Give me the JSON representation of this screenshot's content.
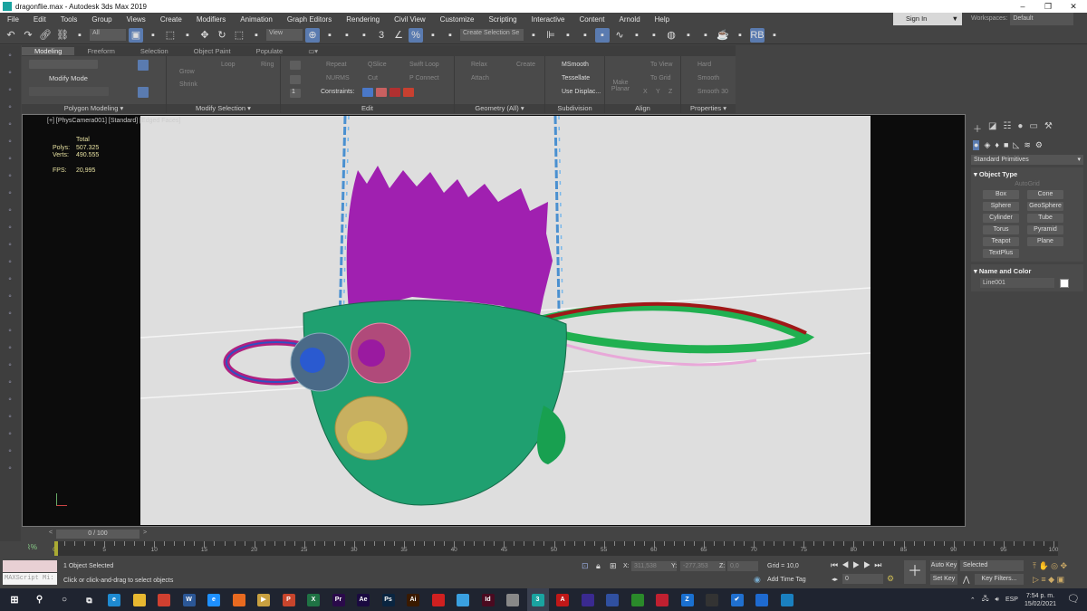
{
  "window": {
    "title": "dragonflie.max - Autodesk 3ds Max 2019",
    "minimize": "–",
    "restore": "❐",
    "close": "✕"
  },
  "menu": [
    "File",
    "Edit",
    "Tools",
    "Group",
    "Views",
    "Create",
    "Modifiers",
    "Animation",
    "Graph Editors",
    "Rendering",
    "Civil View",
    "Customize",
    "Scripting",
    "Interactive",
    "Content",
    "Arnold",
    "Help"
  ],
  "account": {
    "sign_in": "Sign In",
    "workspaces_label": "Workspaces:",
    "workspace": "Default"
  },
  "toolbar": {
    "selection_filter": "All",
    "ref_coord": "View",
    "named_selection": "Create Selection Se",
    "icons": [
      "undo-icon",
      "redo-icon",
      "link-icon",
      "unlink-icon",
      "bind-space-warp-icon",
      "select-object-icon",
      "select-by-name-icon",
      "rect-region-icon",
      "window-crossing-icon",
      "move-icon",
      "rotate-icon",
      "scale-icon",
      "place-icon",
      "pivot-icon",
      "mirror-icon",
      "select-manipulate-icon",
      "keyboard-shortcut-icon",
      "snap-3d-icon",
      "angle-snap-icon",
      "percent-snap-icon",
      "spinner-snap-icon",
      "edit-named-sets-icon",
      "mirror-tool-icon",
      "align-icon",
      "scene-explorer-icon",
      "layer-explorer-icon",
      "toggle-ribbon-icon",
      "curve-editor-icon",
      "dope-sheet-icon",
      "schematic-view-icon",
      "material-editor-icon",
      "render-setup-icon",
      "rendered-frame-icon",
      "render-icon",
      "render-iterative-icon",
      "rb-icon",
      "viewport-layout-icon"
    ]
  },
  "ribbon": {
    "tabs": [
      "Modeling",
      "Freeform",
      "Selection",
      "Object Paint",
      "Populate"
    ],
    "selected_tab": "Modeling",
    "panels": {
      "polygon_modeling": {
        "label": "Polygon Modeling ▾",
        "modify_mode": "Modify Mode"
      },
      "modify_selection": {
        "label": "Modify Selection ▾",
        "grow": "Grow",
        "shrink": "Shrink",
        "loop": "Loop",
        "ring": "Ring"
      },
      "edit": {
        "label": "Edit",
        "repeat": "Repeat",
        "qslice": "QSlice",
        "swift_loop": "Swift Loop",
        "nurms": "NURMS",
        "cut": "Cut",
        "p_connect": "P Connect",
        "constraints": "Constraints:",
        "spinner_value": "1"
      },
      "geometry": {
        "label": "Geometry (All) ▾",
        "relax": "Relax",
        "create": "Create",
        "attach": "Attach"
      },
      "subdivision": {
        "label": "Subdivision",
        "msmooth": "MSmooth",
        "tessellate": "Tessellate",
        "use_displace": "Use Displac..."
      },
      "align": {
        "label": "Align",
        "make_planar": "Make Planar",
        "to_view": "To View",
        "to_grid": "To Grid",
        "x": "X",
        "y": "Y",
        "z": "Z"
      },
      "properties": {
        "label": "Properties ▾",
        "hard": "Hard",
        "smooth": "Smooth",
        "smooth30": "Smooth 30"
      }
    }
  },
  "viewport": {
    "label": "[+] [PhysCamera001] [Standard] [Edged Faces]",
    "stats": {
      "total_label": "Total",
      "polys_label": "Polys:",
      "polys": "507.325",
      "verts_label": "Verts:",
      "verts": "490.555",
      "fps_label": "FPS:",
      "fps": "20,995"
    },
    "colors": {
      "background": "#dedede",
      "chain": "#4a90d0",
      "plant": "#a020b0",
      "bowl": "#1fa070",
      "wing_green": "#20b050",
      "wing_red": "#a01818"
    }
  },
  "command_panel": {
    "category": "Standard Primitives",
    "object_type": {
      "title": "Object Type",
      "autogrid": "AutoGrid",
      "buttons": [
        "Box",
        "Cone",
        "Sphere",
        "GeoSphere",
        "Cylinder",
        "Tube",
        "Torus",
        "Pyramid",
        "Teapot",
        "Plane",
        "TextPlus"
      ]
    },
    "name_and_color": {
      "title": "Name and Color",
      "name": "Line001",
      "color": "#ffffff"
    }
  },
  "timeline": {
    "frame": "0 / 100",
    "prev": "<",
    "next": ">",
    "ticks": [
      0,
      5,
      10,
      15,
      20,
      25,
      30,
      35,
      40,
      45,
      50,
      55,
      60,
      65,
      70,
      75,
      80,
      85,
      90,
      95,
      100
    ]
  },
  "status": {
    "maxscript": "MAXScript Mi:",
    "selection": "1 Object Selected",
    "prompt": "Click or click-and-drag to select objects",
    "x_label": "X:",
    "x": "311,538",
    "y_label": "Y:",
    "y": "-277,353",
    "z_label": "Z:",
    "z": "0,0",
    "grid": "Grid = 10,0",
    "add_time_tag": "Add Time Tag",
    "current_frame": "0",
    "auto_key": "Auto Key",
    "set_key": "Set Key",
    "key_mode": "Selected",
    "key_filters": "Key Filters..."
  },
  "taskbar": {
    "apps": [
      {
        "name": "edge",
        "label": "e",
        "color": "#1e8ad0"
      },
      {
        "name": "file-explorer",
        "label": "",
        "color": "#e8b830"
      },
      {
        "name": "chrome",
        "label": "",
        "color": "#d04030"
      },
      {
        "name": "word",
        "label": "W",
        "color": "#2b5797"
      },
      {
        "name": "internet-explorer",
        "label": "e",
        "color": "#1e90ff"
      },
      {
        "name": "firefox",
        "label": "",
        "color": "#e86a20"
      },
      {
        "name": "media-player",
        "label": "▶",
        "color": "#c8a040"
      },
      {
        "name": "powerpoint",
        "label": "P",
        "color": "#c8452c"
      },
      {
        "name": "excel",
        "label": "X",
        "color": "#1f7244"
      },
      {
        "name": "premiere",
        "label": "Pr",
        "color": "#2a0a4a"
      },
      {
        "name": "after-effects",
        "label": "Ae",
        "color": "#1a0a40"
      },
      {
        "name": "photoshop",
        "label": "Ps",
        "color": "#0a2540"
      },
      {
        "name": "illustrator",
        "label": "Ai",
        "color": "#3a1a00"
      },
      {
        "name": "sketchup",
        "label": "",
        "color": "#d02020"
      },
      {
        "name": "settings-app",
        "label": "",
        "color": "#3aa0e0"
      },
      {
        "name": "indesign",
        "label": "Id",
        "color": "#4a0a20"
      },
      {
        "name": "app-bird",
        "label": "",
        "color": "#888"
      },
      {
        "name": "3ds-max",
        "label": "3",
        "color": "#1aa3a0"
      },
      {
        "name": "autocad",
        "label": "A",
        "color": "#c01818"
      },
      {
        "name": "app-purple",
        "label": "",
        "color": "#3a2a90"
      },
      {
        "name": "cinema4d",
        "label": "",
        "color": "#3050a0"
      },
      {
        "name": "app-green",
        "label": "",
        "color": "#2a8a2a"
      },
      {
        "name": "app-red",
        "label": "",
        "color": "#c02030"
      },
      {
        "name": "zbrush",
        "label": "Z",
        "color": "#1a70d0"
      },
      {
        "name": "obs",
        "label": "",
        "color": "#333"
      },
      {
        "name": "todo",
        "label": "✔",
        "color": "#2070d0"
      },
      {
        "name": "mail",
        "label": "",
        "color": "#1e6ad0"
      },
      {
        "name": "photos",
        "label": "",
        "color": "#1a80c0"
      }
    ],
    "language": "ESP",
    "time": "7:54 p. m.",
    "date": "15/02/2021"
  }
}
